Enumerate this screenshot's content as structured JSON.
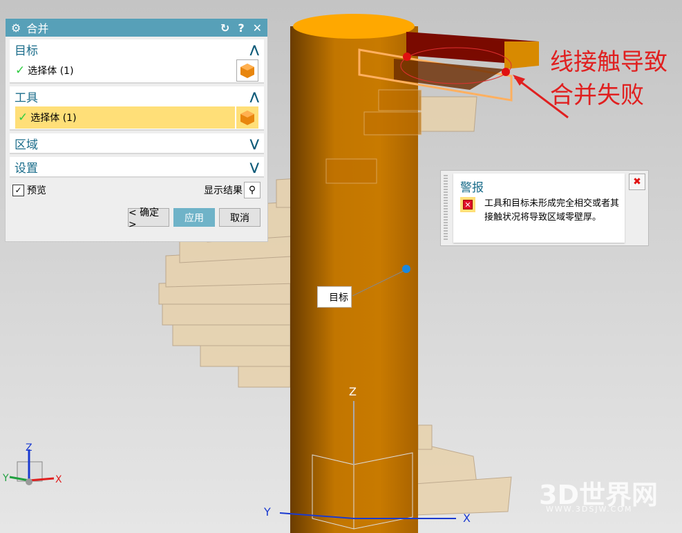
{
  "dialog": {
    "title": "合并",
    "icons": [
      "gear-icon",
      "reset-icon",
      "help-icon",
      "close-icon"
    ],
    "sections": [
      {
        "label": "目标",
        "expanded": true,
        "select_label": "选择体 (1)"
      },
      {
        "label": "工具",
        "expanded": true,
        "select_label": "选择体 (1)"
      },
      {
        "label": "区域",
        "expanded": false
      },
      {
        "label": "设置",
        "expanded": false
      }
    ],
    "preview_label": "预览",
    "preview_checked": true,
    "show_result_label": "显示结果",
    "ok_label": "< 确定 >",
    "apply_label": "应用",
    "cancel_label": "取消"
  },
  "alert": {
    "title": "警报",
    "message": "工具和目标未形成完全相交或者其接触状况将导致区域零壁厚。"
  },
  "annotation": {
    "line1": "线接触导致",
    "line2": "合并失败"
  },
  "viewport": {
    "target_tag": "目标",
    "axis_z": "Z",
    "axis_x": "X",
    "axis_y": "Y"
  },
  "watermark": {
    "main": "3D世界网",
    "sub": "WWW.3DSJW.COM"
  },
  "colors": {
    "accent": "#57a0b8",
    "body": "#c87a00",
    "highlight": "#ffdf78",
    "error": "#e02020"
  }
}
